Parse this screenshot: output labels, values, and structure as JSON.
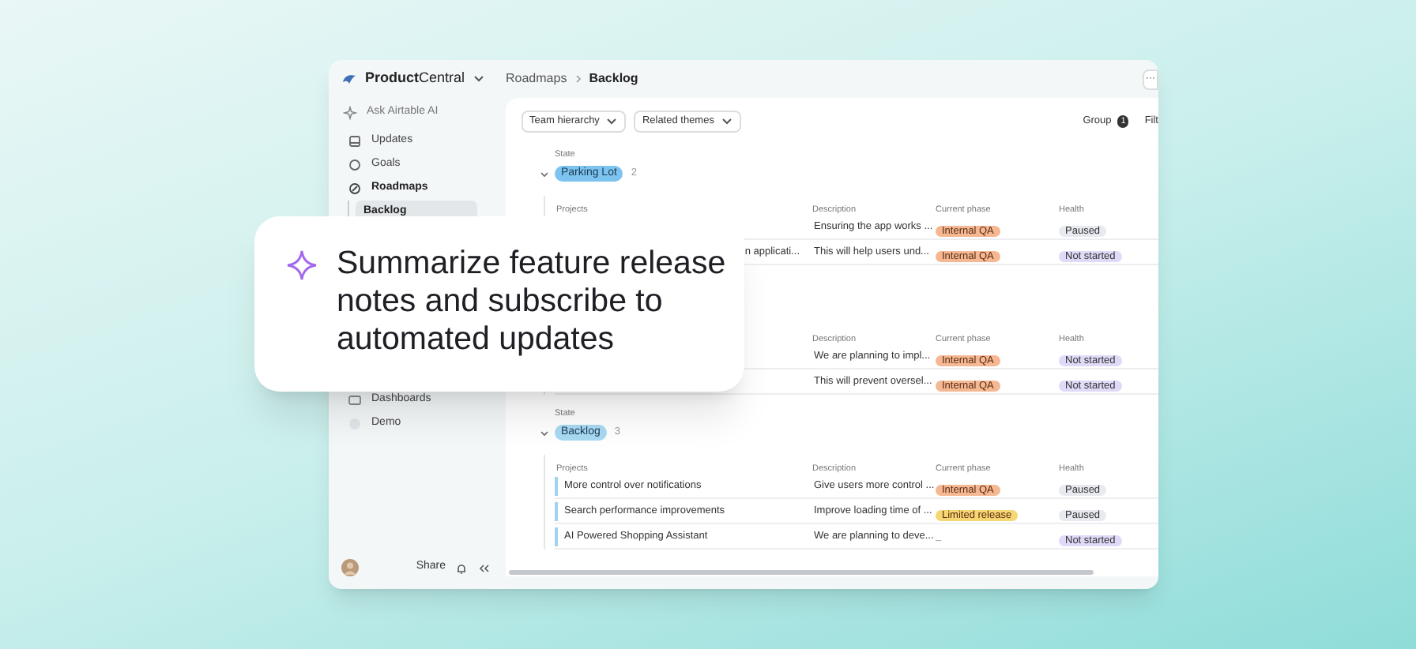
{
  "workspace": {
    "name": "**Product**Central"
  },
  "sidebar": {
    "ask_ai": "Ask Airtable AI",
    "items": [
      {
        "label": "Updates",
        "kind": "updates",
        "expanded": false,
        "selected": false
      },
      {
        "label": "Goals",
        "kind": "goals",
        "expanded": false,
        "selected": false
      },
      {
        "label": "Roadmaps",
        "kind": "roadmaps",
        "expanded": true,
        "selected": false,
        "children": [
          {
            "label": "Backlog",
            "selected": true
          }
        ]
      },
      {
        "label": "Dashboards",
        "kind": "dashboards",
        "expanded": false,
        "selected": false
      },
      {
        "label": "Demo",
        "kind": "demo",
        "expanded": false,
        "selected": false
      }
    ],
    "share": "Share"
  },
  "breadcrumb": [
    "Roadmaps",
    "Backlog"
  ],
  "more_button": "···",
  "toolbar": {
    "filters": [
      "Team hierarchy",
      "Related themes"
    ],
    "group": {
      "label": "Group",
      "count": "1"
    },
    "filter_label": "Filt"
  },
  "groups": [
    {
      "state_label": "State",
      "name": "Parking Lot",
      "color": "#7cc4ef",
      "count": "2",
      "columns": [
        "Projects",
        "Description",
        "Current phase",
        "Health"
      ],
      "rows": [
        {
          "description": "Ensuring the app works ...",
          "phase": {
            "label": "Internal QA",
            "color": "#f5b893"
          },
          "health": {
            "label": "Paused",
            "color": "#e8eaf0"
          }
        },
        {
          "project": "n applicati...",
          "description": "This will help users und...",
          "phase": {
            "label": "Internal QA",
            "color": "#f5b893"
          },
          "health": {
            "label": "Not started",
            "color": "#e0daf8"
          }
        }
      ]
    },
    {
      "columns": [
        "Description",
        "Current phase",
        "Health"
      ],
      "rows": [
        {
          "description": "We are planning to impl...",
          "phase": {
            "label": "Internal QA",
            "color": "#f5b893"
          },
          "health": {
            "label": "Not started",
            "color": "#e0daf8"
          }
        },
        {
          "description": "This will prevent oversel...",
          "phase": {
            "label": "Internal QA",
            "color": "#f5b893"
          },
          "health": {
            "label": "Not started",
            "color": "#e0daf8"
          }
        }
      ]
    },
    {
      "state_label": "State",
      "name": "Backlog",
      "color": "#a9daf3",
      "count": "3",
      "columns": [
        "Projects",
        "Description",
        "Current phase",
        "Health"
      ],
      "rows": [
        {
          "project": "More control over notifications",
          "description": "Give users more control ...",
          "phase": {
            "label": "Internal QA",
            "color": "#f5b893"
          },
          "health": {
            "label": "Paused",
            "color": "#e8eaf0"
          }
        },
        {
          "project": "Search performance improvements",
          "description": "Improve loading time of ...",
          "phase": {
            "label": "Limited release",
            "color": "#f7d774"
          },
          "health": {
            "label": "Paused",
            "color": "#e8eaf0"
          }
        },
        {
          "project": "AI Powered Shopping Assistant",
          "description": "We are planning to deve...",
          "phase": {
            "label": "–"
          },
          "health": {
            "label": "Not started",
            "color": "#e0daf8"
          }
        }
      ]
    }
  ],
  "callout": {
    "text": "Summarize feature release notes and subscribe to automated updates"
  }
}
